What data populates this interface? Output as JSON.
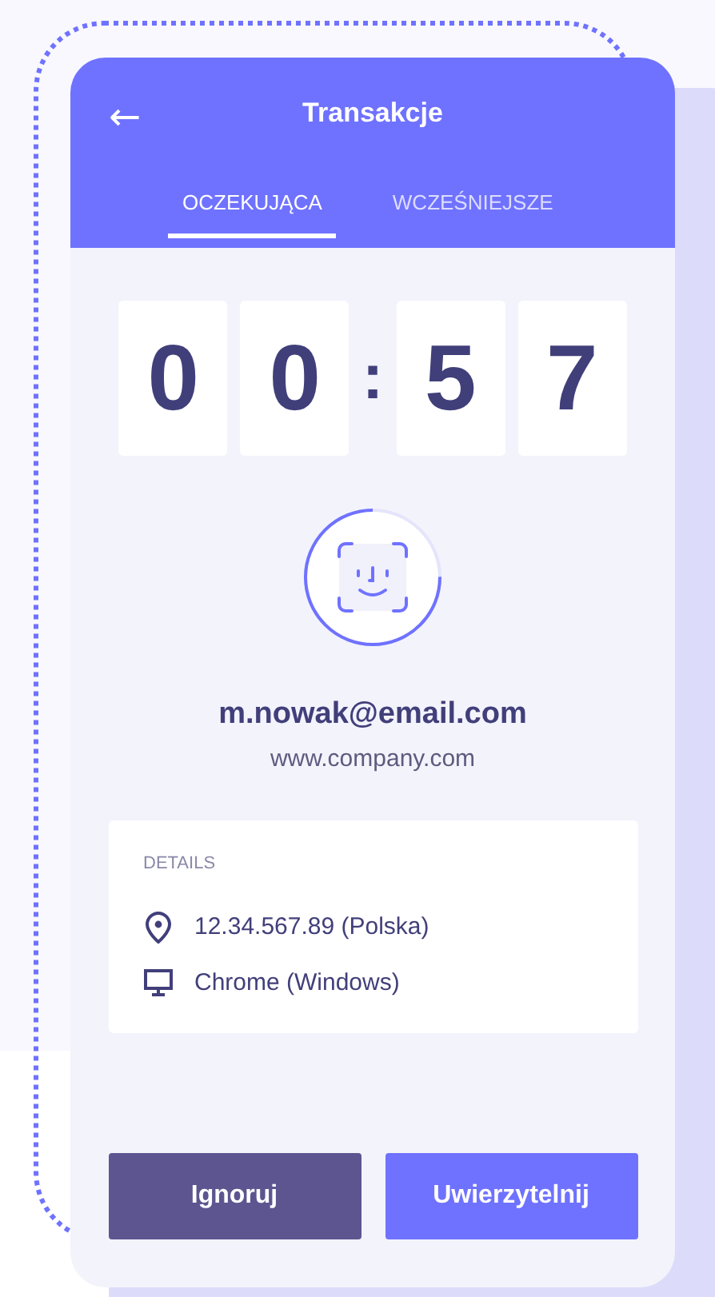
{
  "header": {
    "back_icon": "←",
    "title": "Transakcje"
  },
  "tabs": [
    {
      "label": "OCZEKUJĄCA",
      "selected": true
    },
    {
      "label": "WCZEŚNIEJSZE",
      "selected": false
    }
  ],
  "timer": {
    "digits": [
      "0",
      "0",
      "5",
      "7"
    ],
    "separator": ":"
  },
  "account": {
    "email": "m.nowak@email.com",
    "website": "www.company.com"
  },
  "details": {
    "title": "DETAILS",
    "rows": [
      {
        "kind": "location",
        "text": "12.34.567.89 (Polska)"
      },
      {
        "kind": "device",
        "text": "Chrome (Windows)"
      }
    ]
  },
  "buttons": [
    {
      "kind": "secondary",
      "label": "Ignoruj"
    },
    {
      "kind": "primary",
      "label": "Uwierzytelnij"
    }
  ]
}
